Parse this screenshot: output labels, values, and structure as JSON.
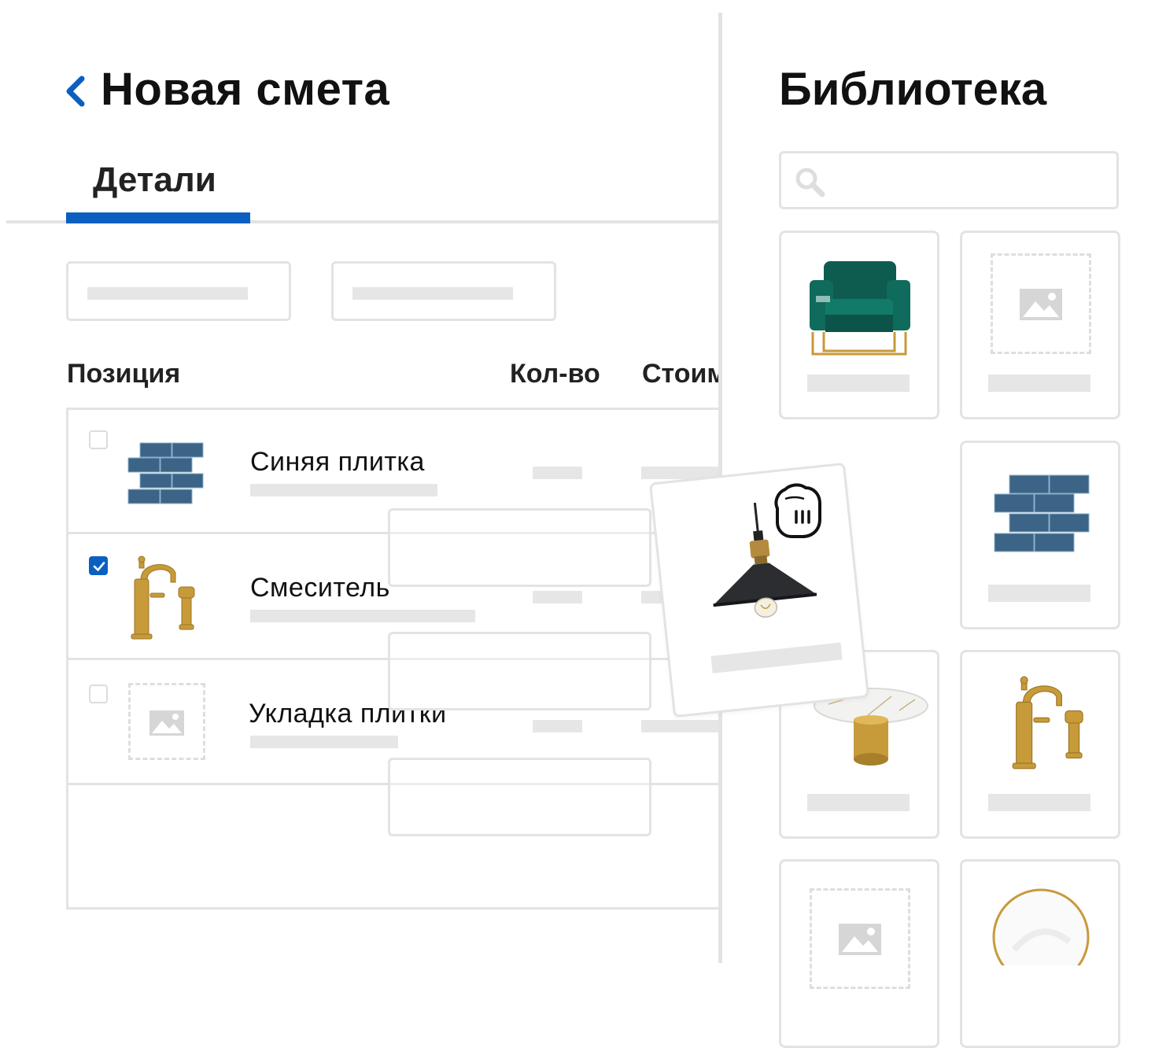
{
  "estimate": {
    "title": "Новая смета",
    "tab_details": "Детали",
    "columns": {
      "item": "Позиция",
      "qty": "Кол-во",
      "cost": "Стоим"
    },
    "rows": [
      {
        "name": "Синяя плитка",
        "checked": false,
        "image": "blue-tile"
      },
      {
        "name": "Смеситель",
        "checked": true,
        "image": "gold-faucet"
      },
      {
        "name": "Укладка плитки",
        "checked": false,
        "image": "image-placeholder"
      }
    ]
  },
  "library": {
    "title": "Библиотека",
    "cards": [
      "green-armchair",
      "image-placeholder",
      "blue-tile",
      "marble-table",
      "gold-faucet",
      "image-placeholder",
      "round-mirror"
    ]
  },
  "drag_item": {
    "image": "pendant-lamp",
    "cursor": "grab-hand-icon"
  },
  "colors": {
    "accent": "#0b5fc1",
    "border": "#e3e3e3",
    "placeholder": "#e6e6e6",
    "tile": "#3b6487",
    "gold": "#c79a3a"
  }
}
